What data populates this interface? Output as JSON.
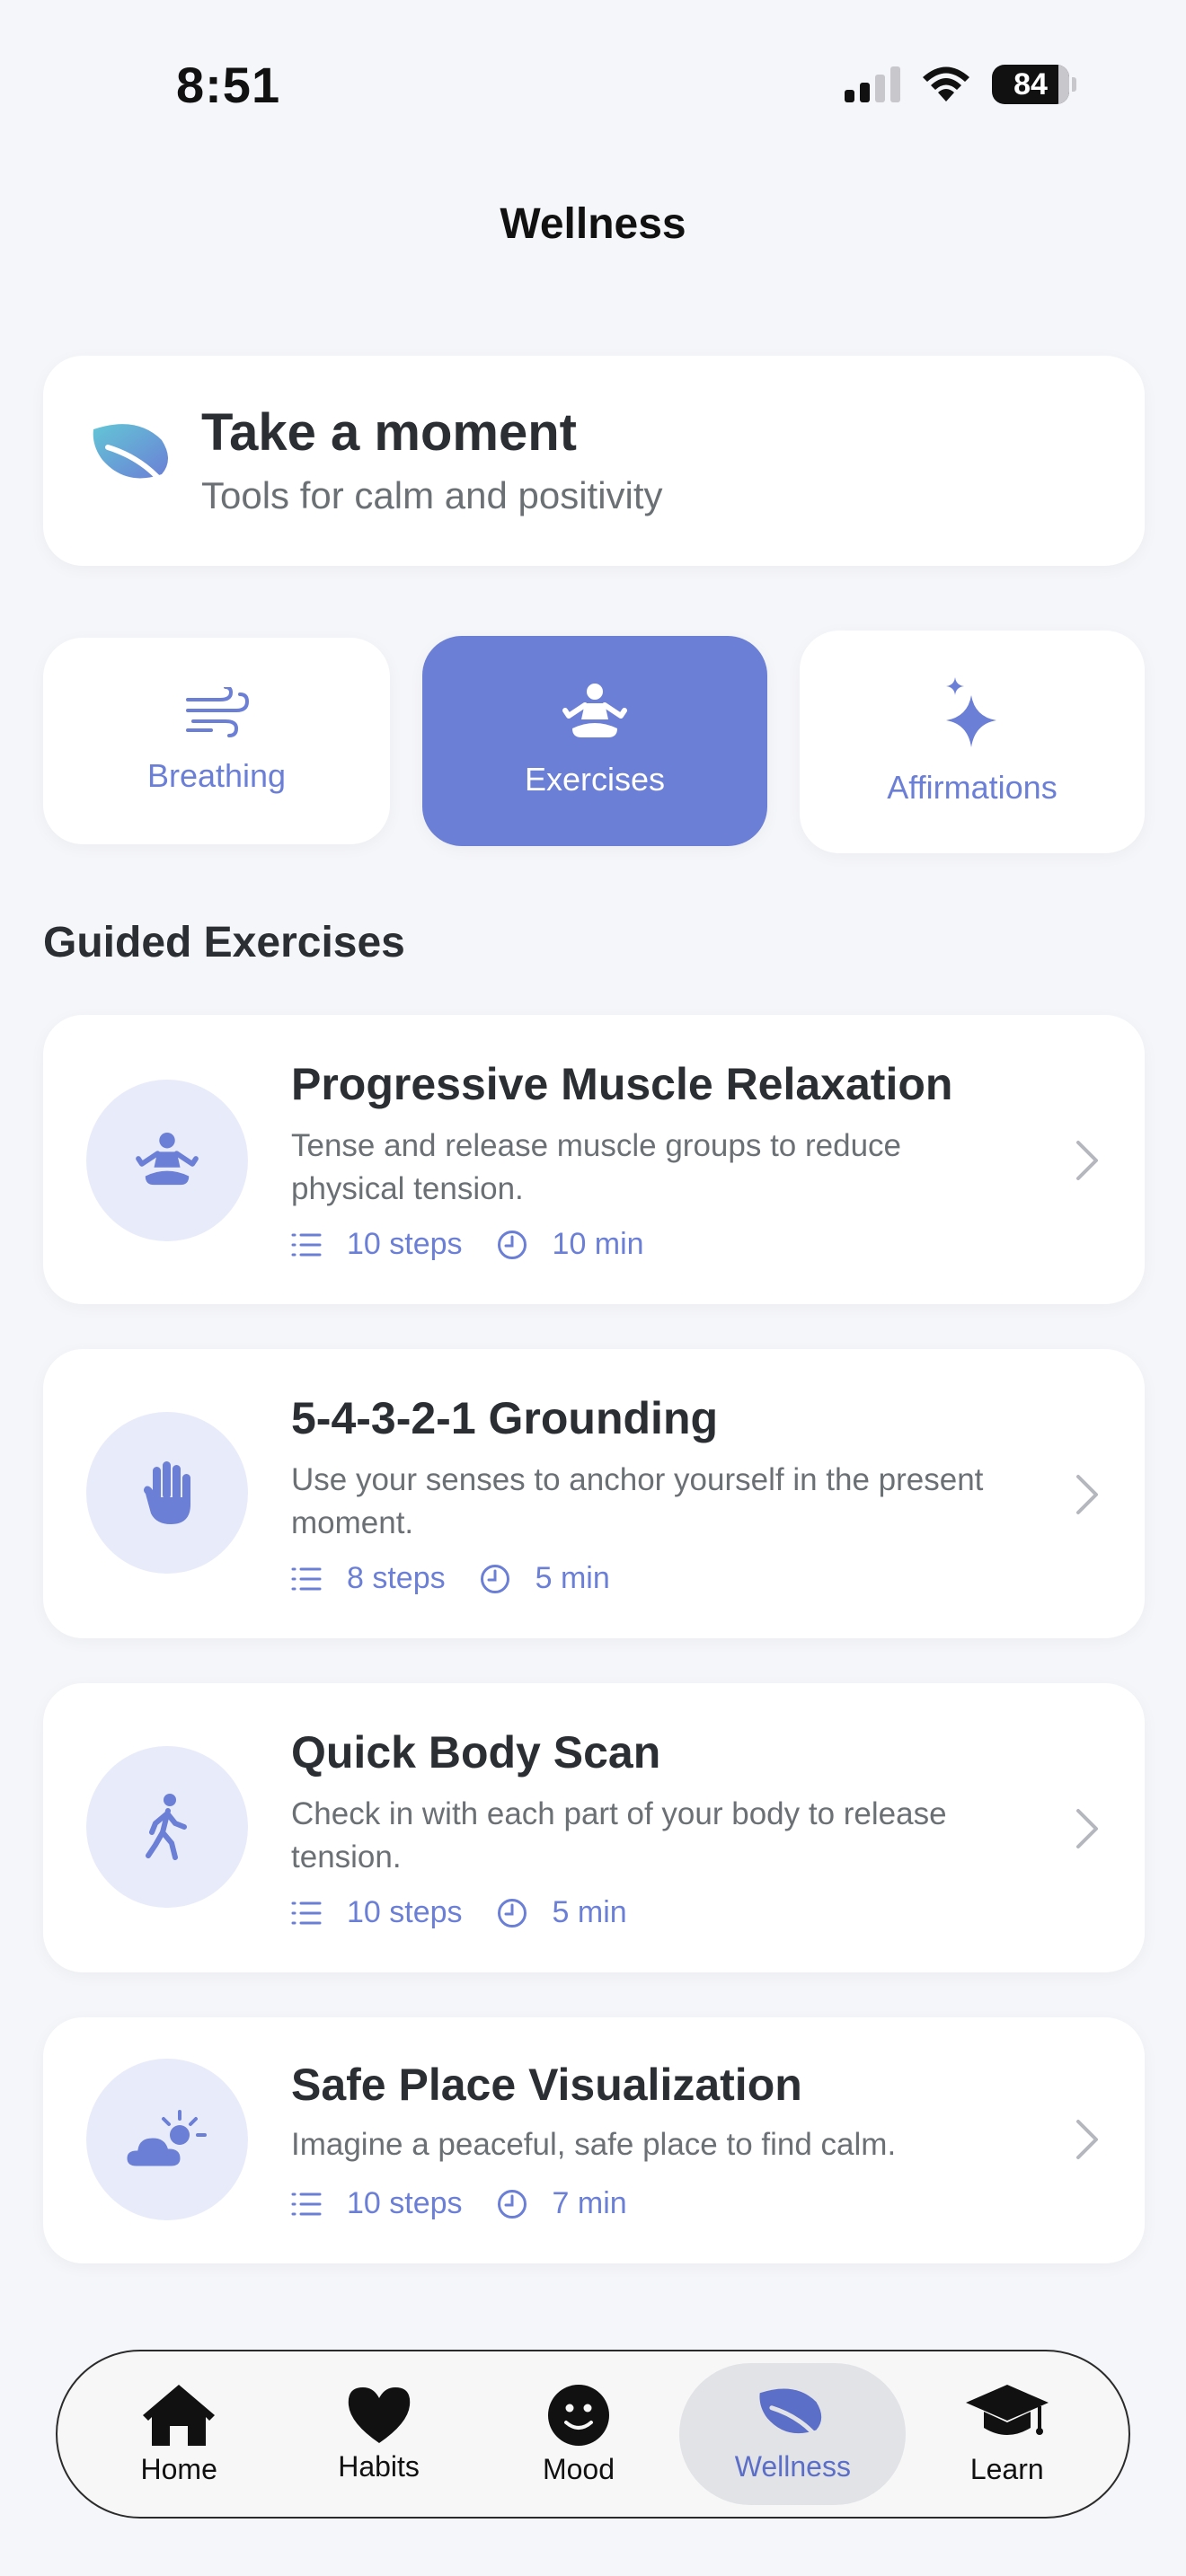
{
  "status": {
    "time": "8:51",
    "battery": "84"
  },
  "header": {
    "title": "Wellness"
  },
  "hero": {
    "title": "Take a moment",
    "subtitle": "Tools for calm and positivity",
    "icon": "leaf-icon"
  },
  "segments": [
    {
      "label": "Breathing",
      "icon": "wind-icon",
      "active": false
    },
    {
      "label": "Exercises",
      "icon": "meditation-icon",
      "active": true
    },
    {
      "label": "Affirmations",
      "icon": "sparkles-icon",
      "active": false
    }
  ],
  "section": {
    "title": "Guided Exercises"
  },
  "exercises": [
    {
      "title": "Progressive Muscle Relaxation",
      "description": "Tense and release muscle groups to reduce physical tension.",
      "steps": "10 steps",
      "duration": "10 min",
      "icon": "meditation-icon"
    },
    {
      "title": "5-4-3-2-1 Grounding",
      "description": "Use your senses to anchor yourself in the present moment.",
      "steps": "8 steps",
      "duration": "5 min",
      "icon": "hand-icon"
    },
    {
      "title": "Quick Body Scan",
      "description": "Check in with each part of your body to release tension.",
      "steps": "10 steps",
      "duration": "5 min",
      "icon": "walking-figure-icon"
    },
    {
      "title": "Safe Place Visualization",
      "description": "Imagine a peaceful, safe place to find calm.",
      "steps": "10 steps",
      "duration": "7 min",
      "icon": "cloud-sun-icon"
    }
  ],
  "tabs": [
    {
      "label": "Home",
      "icon": "house-icon",
      "active": false
    },
    {
      "label": "Habits",
      "icon": "heart-icon",
      "active": false
    },
    {
      "label": "Mood",
      "icon": "smiley-icon",
      "active": false
    },
    {
      "label": "Wellness",
      "icon": "leaf-icon",
      "active": true
    },
    {
      "label": "Learn",
      "icon": "graduation-cap-icon",
      "active": false
    }
  ],
  "colors": {
    "accent": "#6b7fd6",
    "background": "#f5f6fa",
    "card": "#ffffff",
    "icon_circle": "#e8ebfa"
  }
}
